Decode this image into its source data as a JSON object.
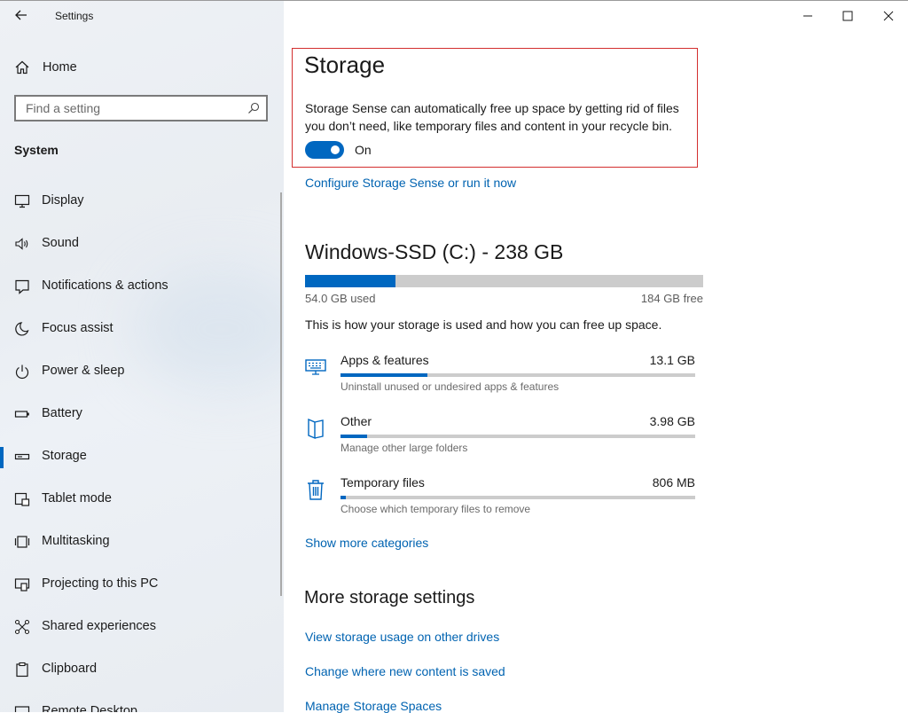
{
  "window": {
    "title": "Settings",
    "controls": [
      "minimize",
      "maximize",
      "close"
    ]
  },
  "sidebar": {
    "home_label": "Home",
    "search_placeholder": "Find a setting",
    "section_title": "System",
    "items": [
      {
        "label": "Display",
        "icon": "display-icon"
      },
      {
        "label": "Sound",
        "icon": "sound-icon"
      },
      {
        "label": "Notifications & actions",
        "icon": "notifications-icon"
      },
      {
        "label": "Focus assist",
        "icon": "moon-icon"
      },
      {
        "label": "Power & sleep",
        "icon": "power-icon"
      },
      {
        "label": "Battery",
        "icon": "battery-icon"
      },
      {
        "label": "Storage",
        "icon": "storage-icon",
        "active": true
      },
      {
        "label": "Tablet mode",
        "icon": "tablet-mode-icon"
      },
      {
        "label": "Multitasking",
        "icon": "multitasking-icon"
      },
      {
        "label": "Projecting to this PC",
        "icon": "projecting-icon"
      },
      {
        "label": "Shared experiences",
        "icon": "shared-experiences-icon"
      },
      {
        "label": "Clipboard",
        "icon": "clipboard-icon"
      },
      {
        "label": "Remote Desktop",
        "icon": "remote-desktop-icon"
      }
    ]
  },
  "main": {
    "title": "Storage",
    "storage_sense_description": "Storage Sense can automatically free up space by getting rid of files you don’t need, like temporary files and content in your recycle bin.",
    "toggle_state": "On",
    "configure_link": "Configure Storage Sense or run it now",
    "drive": {
      "title": "Windows-SSD (C:) - 238 GB",
      "used": "54.0 GB used",
      "free": "184 GB free",
      "used_fraction": 0.227
    },
    "usage_text": "This is how your storage is used and how you can free up space.",
    "categories": [
      {
        "name": "Apps & features",
        "size": "13.1 GB",
        "description": "Uninstall unused or undesired apps & features",
        "fraction": 0.245,
        "icon": "apps-features-icon"
      },
      {
        "name": "Other",
        "size": "3.98 GB",
        "description": "Manage other large folders",
        "fraction": 0.075,
        "icon": "other-folder-icon"
      },
      {
        "name": "Temporary files",
        "size": "806 MB",
        "description": "Choose which temporary files to remove",
        "fraction": 0.015,
        "icon": "trash-icon"
      }
    ],
    "show_more_link": "Show more categories",
    "more_title": "More storage settings",
    "more_links": [
      "View storage usage on other drives",
      "Change where new content is saved",
      "Manage Storage Spaces"
    ]
  },
  "colors": {
    "accent": "#0067c0",
    "link": "#0063b1",
    "highlight_border": "#d32f2f",
    "bar_track": "#cccccc"
  }
}
